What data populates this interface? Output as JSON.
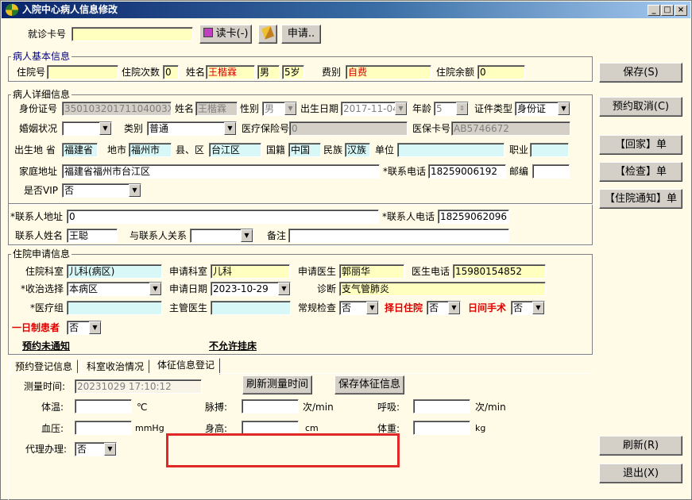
{
  "window": {
    "title": "入院中心病人信息修改"
  },
  "card": {
    "label": "就诊卡号",
    "value": "",
    "read_btn": "读卡(-)",
    "apply_btn": "申请.."
  },
  "basic": {
    "title": "病人基本信息",
    "admission_no_label": "住院号",
    "admission_no": "",
    "times_label": "住院次数",
    "times": "0",
    "name_label": "姓名",
    "name": "王楷霖",
    "sex": "男",
    "age": "5岁",
    "fee_label": "费别",
    "fee": "自费",
    "balance_label": "住院余额",
    "balance": "0"
  },
  "detail": {
    "title": "病人详细信息",
    "id_label": "身份证号",
    "id": "35010320171104003X",
    "name_label": "姓名",
    "name": "王楷霖",
    "sex_label": "性别",
    "sex": "男",
    "birth_label": "出生日期",
    "birth": "2017-11-04",
    "age_label": "年龄",
    "age": "5",
    "idtype_label": "证件类型",
    "idtype": "身份证",
    "marital_label": "婚姻状况",
    "marital": "",
    "category_label": "类别",
    "category": "普通",
    "insurance_label": "医疗保险号",
    "insurance": "0",
    "card_label": "医保卡号",
    "card": "AB5746672",
    "birthplace_label": "出生地 省",
    "province": "福建省",
    "city_label": "地市",
    "city": "福州市",
    "county_label": "县、区",
    "county": "台江区",
    "nation_label": "国籍",
    "nation": "中国",
    "ethnic_label": "民族",
    "ethnic": "汉族",
    "unit_label": "单位",
    "unit": "",
    "job_label": "职业",
    "job": "",
    "address_label": "家庭地址",
    "address": "福建省福州市台江区",
    "phone_label": "*联系电话",
    "phone": "18259006192",
    "zip_label": "邮编",
    "zip": "",
    "vip_label": "是否VIP",
    "vip": "否",
    "contact_addr_label": "*联系人地址",
    "contact_addr": "0",
    "contact_phone_label": "*联系人电话",
    "contact_phone": "18259062096",
    "contact_name_label": "联系人姓名",
    "contact_name": "王聪",
    "relation_label": "与联系人关系",
    "relation": "",
    "remark_label": "备注",
    "remark": ""
  },
  "apply": {
    "title": "住院申请信息",
    "dept_label": "住院科室",
    "dept": "儿科(病区)",
    "apply_dept_label": "申请科室",
    "apply_dept": "儿科",
    "doctor_label": "申请医生",
    "doctor": "郭丽华",
    "doctor_phone_label": "医生电话",
    "doctor_phone": "15980154852",
    "admit_label": "*收治选择",
    "admit": "本病区",
    "apply_date_label": "申请日期",
    "apply_date": "2023-10-29",
    "diag_label": "诊断",
    "diag": "支气管肺炎",
    "group_label": "*医疗组",
    "group": "",
    "chief_label": "主管医生",
    "chief": "",
    "routine_label": "常规检查",
    "routine": "否",
    "select_day_label": "择日住院",
    "select_day": "否",
    "day_surgery_label": "日间手术",
    "day_surgery": "否",
    "one_day_label": "一日制患者",
    "one_day": "否",
    "not_notified": "预约未通知",
    "no_register": "不允许挂床"
  },
  "tabs": [
    "预约登记信息",
    "科室收治情况",
    "体征信息登记"
  ],
  "vitals": {
    "time_label": "测量时间:",
    "time": "20231029 17:10:12",
    "refresh_btn": "刷新测量时间",
    "save_btn": "保存体征信息",
    "temp_label": "体温:",
    "temp": "",
    "temp_unit": "℃",
    "pulse_label": "脉搏:",
    "pulse": "",
    "pulse_unit": "次/min",
    "resp_label": "呼吸:",
    "resp": "",
    "resp_unit": "次/min",
    "bp_label": "血压:",
    "bp": "",
    "bp_unit": "mmHg",
    "height_label": "身高:",
    "height": "",
    "height_unit": "cm",
    "weight_label": "体重:",
    "weight": "",
    "weight_unit": "kg",
    "proxy_label": "代理办理:",
    "proxy": "否"
  },
  "side": {
    "save": "保存(S)",
    "cancel": "预约取消(C)",
    "home": "【回家】单",
    "check": "【检查】单",
    "notice": "【住院通知】单",
    "refresh": "刷新(R)",
    "exit": "退出(X)"
  },
  "colors": {
    "highlight_box": "#e02828",
    "field_yellow": "#ffffc0",
    "field_cyan": "#d8f8f8",
    "red_text": "#e00000"
  }
}
